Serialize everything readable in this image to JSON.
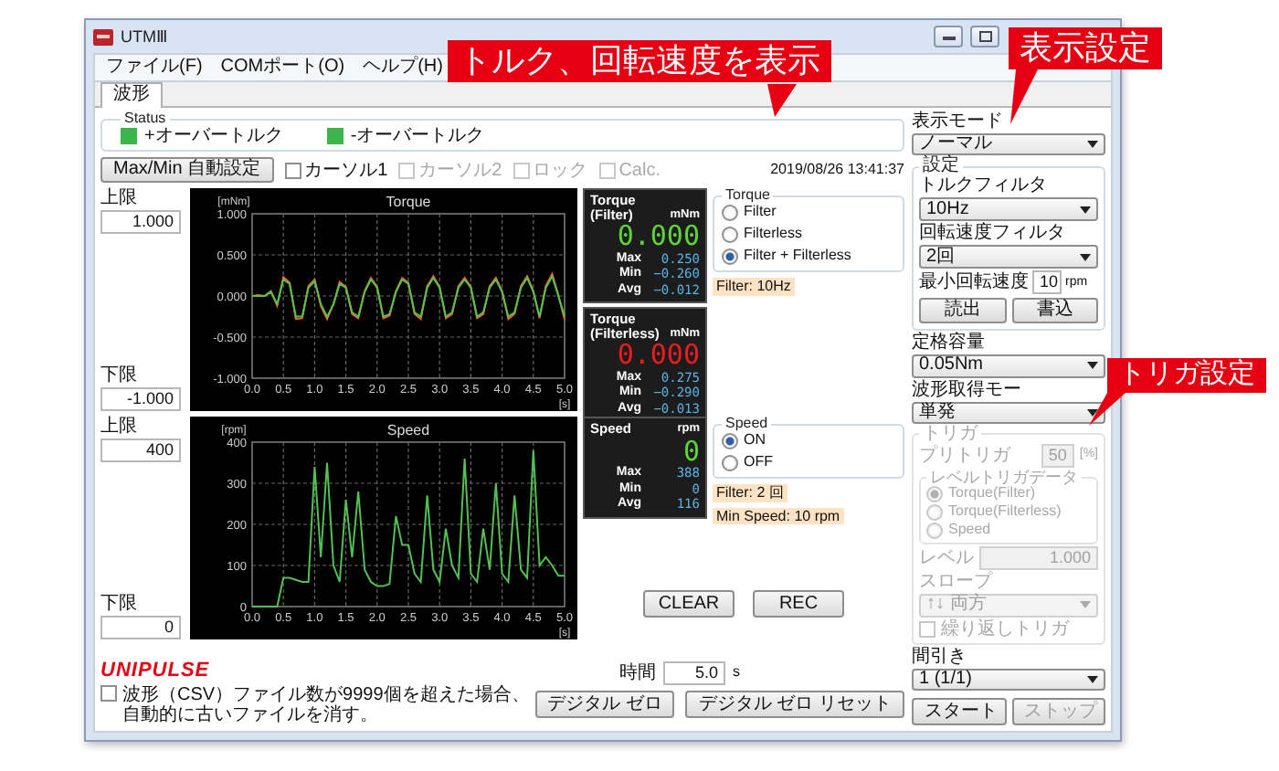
{
  "window": {
    "title": "UTMⅢ"
  },
  "menu": [
    "ファイル(F)",
    "COMポート(O)",
    "ヘルプ(H)"
  ],
  "tabs": [
    {
      "label": "波形",
      "selected": true
    }
  ],
  "status": {
    "label": "Status",
    "indicators": [
      {
        "label": "+オーバートルク",
        "color": "#3db54a"
      },
      {
        "label": "-オーバートルク",
        "color": "#3db54a"
      }
    ]
  },
  "toolbar": {
    "auto_button": "Max/Min 自動設定",
    "checkboxes": [
      {
        "label": "カーソル1",
        "checked": false,
        "disabled": false
      },
      {
        "label": "カーソル2",
        "checked": false,
        "disabled": true
      },
      {
        "label": "ロック",
        "checked": false,
        "disabled": true
      },
      {
        "label": "Calc.",
        "checked": false,
        "disabled": true
      }
    ],
    "timestamp": "2019/08/26 13:41:37"
  },
  "blocks": [
    {
      "upper": {
        "label": "上限",
        "value": "1.000"
      },
      "lower": {
        "label": "下限",
        "value": "-1.000"
      },
      "chart_data": {
        "type": "line",
        "grid": true,
        "title": "Torque",
        "ylabel": "[mNm]",
        "xlabel": "[s]",
        "xlim": [
          0,
          5
        ],
        "ylim": [
          -1,
          1
        ],
        "xticks": [
          {
            "value": 0,
            "label": "0.0"
          },
          {
            "value": 0.5,
            "label": "0.5"
          },
          {
            "value": 1,
            "label": "1.0"
          },
          {
            "value": 1.5,
            "label": "1.5"
          },
          {
            "value": 2,
            "label": "2.0"
          },
          {
            "value": 2.5,
            "label": "2.5"
          },
          {
            "value": 3,
            "label": "3.0"
          },
          {
            "value": 3.5,
            "label": "3.5"
          },
          {
            "value": 4,
            "label": "4.0"
          },
          {
            "value": 4.5,
            "label": "4.5"
          },
          {
            "value": 5,
            "label": "5.0"
          }
        ],
        "yticks": [
          {
            "value": -1,
            "label": "-1.000"
          },
          {
            "value": -0.5,
            "label": "-0.500"
          },
          {
            "value": 0,
            "label": "0.000"
          },
          {
            "value": 0.5,
            "label": "0.500"
          },
          {
            "value": 1,
            "label": "1.000"
          }
        ],
        "x": [
          0,
          0.1,
          0.2,
          0.3,
          0.4,
          0.5,
          0.6,
          0.7,
          0.8,
          0.9,
          1,
          1.1,
          1.2,
          1.3,
          1.4,
          1.5,
          1.6,
          1.7,
          1.8,
          1.9,
          2,
          2.1,
          2.2,
          2.3,
          2.4,
          2.5,
          2.6,
          2.7,
          2.8,
          2.9,
          3,
          3.1,
          3.2,
          3.3,
          3.4,
          3.5,
          3.6,
          3.7,
          3.8,
          3.9,
          4,
          4.1,
          4.2,
          4.3,
          4.4,
          4.5,
          4.6,
          4.7,
          4.8,
          4.9,
          5
        ],
        "series": [
          {
            "color": "#ff5a36",
            "values": [
              0,
              0.01,
              0,
              0.06,
              -0.12,
              0.23,
              0.16,
              -0.28,
              -0.27,
              0.12,
              0.2,
              -0.12,
              -0.28,
              -0.1,
              0.17,
              0.11,
              -0.22,
              -0.27,
              0.06,
              0.22,
              0.11,
              -0.27,
              -0.24,
              0.06,
              0.22,
              0.16,
              -0.22,
              -0.28,
              0.12,
              0.24,
              0.11,
              -0.27,
              -0.22,
              0.12,
              0.22,
              0.11,
              -0.27,
              -0.22,
              0.12,
              0.22,
              0.06,
              -0.28,
              -0.22,
              0.12,
              0.24,
              0.06,
              -0.27,
              0.12,
              0.27,
              0.01,
              -0.29
            ]
          },
          {
            "color": "#4fc64a",
            "values": [
              0,
              0,
              0,
              0.05,
              -0.1,
              0.2,
              0.15,
              -0.25,
              -0.25,
              0.1,
              0.18,
              -0.1,
              -0.25,
              -0.1,
              0.15,
              0.1,
              -0.2,
              -0.25,
              0.05,
              0.2,
              0.1,
              -0.25,
              -0.22,
              0.05,
              0.2,
              0.15,
              -0.2,
              -0.25,
              0.1,
              0.22,
              0.1,
              -0.25,
              -0.2,
              0.1,
              0.2,
              0.1,
              -0.25,
              -0.2,
              0.1,
              0.2,
              0.05,
              -0.25,
              -0.2,
              0.1,
              0.22,
              0.05,
              -0.25,
              0.1,
              0.24,
              0,
              -0.25
            ]
          }
        ]
      },
      "readouts": [
        {
          "title": [
            "Torque",
            "(Filter)"
          ],
          "unit": "mNm",
          "value": "0.000",
          "color": "#5fd43a",
          "stats": [
            {
              "label": "Max",
              "value": "0.250"
            },
            {
              "label": "Min",
              "value": "−0.260"
            },
            {
              "label": "Avg",
              "value": "−0.012"
            }
          ]
        },
        {
          "title": [
            "Torque",
            "(Filterless)"
          ],
          "unit": "mNm",
          "value": "0.000",
          "color": "#ee1c1c",
          "stats": [
            {
              "label": "Max",
              "value": "0.275"
            },
            {
              "label": "Min",
              "value": "−0.290"
            },
            {
              "label": "Avg",
              "value": "−0.013"
            }
          ]
        }
      ],
      "options": {
        "title": "Torque",
        "items": [
          {
            "label": "Filter",
            "selected": false
          },
          {
            "label": "Filterless",
            "selected": false
          },
          {
            "label": "Filter + Filterless",
            "selected": true
          }
        ]
      },
      "notes": [
        "Filter: 10Hz"
      ]
    },
    {
      "upper": {
        "label": "上限",
        "value": "400"
      },
      "lower": {
        "label": "下限",
        "value": "0"
      },
      "chart_data": {
        "type": "line",
        "grid": true,
        "title": "Speed",
        "ylabel": "[rpm]",
        "xlabel": "[s]",
        "xlim": [
          0,
          5
        ],
        "ylim": [
          0,
          400
        ],
        "xticks": [
          {
            "value": 0,
            "label": "0.0"
          },
          {
            "value": 0.5,
            "label": "0.5"
          },
          {
            "value": 1,
            "label": "1.0"
          },
          {
            "value": 1.5,
            "label": "1.5"
          },
          {
            "value": 2,
            "label": "2.0"
          },
          {
            "value": 2.5,
            "label": "2.5"
          },
          {
            "value": 3,
            "label": "3.0"
          },
          {
            "value": 3.5,
            "label": "3.5"
          },
          {
            "value": 4,
            "label": "4.0"
          },
          {
            "value": 4.5,
            "label": "4.5"
          },
          {
            "value": 5,
            "label": "5.0"
          }
        ],
        "yticks": [
          0,
          100,
          200,
          300,
          400
        ],
        "x": [
          0,
          0.1,
          0.2,
          0.3,
          0.4,
          0.5,
          0.6,
          0.7,
          0.8,
          0.9,
          1,
          1.1,
          1.2,
          1.3,
          1.4,
          1.5,
          1.6,
          1.7,
          1.8,
          1.9,
          2,
          2.1,
          2.2,
          2.3,
          2.4,
          2.5,
          2.6,
          2.7,
          2.8,
          2.9,
          3,
          3.1,
          3.2,
          3.3,
          3.4,
          3.5,
          3.6,
          3.7,
          3.8,
          3.9,
          4,
          4.1,
          4.2,
          4.3,
          4.4,
          4.5,
          4.6,
          4.7,
          4.8,
          4.9,
          5
        ],
        "series": [
          {
            "color": "#52c052",
            "values": [
              0,
              0,
              0,
              0,
              0,
              70,
              70,
              65,
              60,
              60,
              340,
              120,
              350,
              100,
              60,
              260,
              120,
              280,
              90,
              60,
              50,
              50,
              55,
              220,
              150,
              150,
              80,
              60,
              270,
              90,
              60,
              190,
              100,
              70,
              360,
              80,
              60,
              190,
              90,
              300,
              80,
              60,
              270,
              90,
              70,
              380,
              100,
              120,
              100,
              75,
              75
            ]
          }
        ]
      },
      "readouts": [
        {
          "title": [
            "Speed"
          ],
          "unit": "rpm",
          "value": "0",
          "color": "#5fd43a",
          "stats": [
            {
              "label": "Max",
              "value": "388"
            },
            {
              "label": "Min",
              "value": "0"
            },
            {
              "label": "Avg",
              "value": "116"
            }
          ]
        }
      ],
      "options": {
        "title": "Speed",
        "items": [
          {
            "label": "ON",
            "selected": true
          },
          {
            "label": "OFF",
            "selected": false
          }
        ]
      },
      "notes": [
        "Filter: 2 回",
        "Min Speed: 10 rpm"
      ]
    }
  ],
  "record_buttons": [
    "CLEAR",
    "REC"
  ],
  "logo": "UNIPULSE",
  "csv_option": {
    "label": "波形（CSV）ファイル数が9999個を超えた場合、自動的に古いファイルを消す。",
    "checked": false
  },
  "time": {
    "label": "時間",
    "value": "5.0",
    "unit": "s"
  },
  "zero_buttons": [
    "デジタル ゼロ",
    "デジタル ゼロ リセット"
  ],
  "side": {
    "display_mode": {
      "label": "表示モード",
      "value": "ノーマル"
    },
    "settings": {
      "title": "設定",
      "torque_filter": {
        "label": "トルクフィルタ",
        "value": "10Hz"
      },
      "speed_filter": {
        "label": "回転速度フィルタ",
        "value": "2回"
      },
      "min_speed": {
        "label": "最小回転速度",
        "value": "10",
        "unit": "rpm"
      },
      "buttons": [
        "読出",
        "書込"
      ]
    },
    "capacity": {
      "label": "定格容量",
      "value": "0.05Nm"
    },
    "acquire_mode": {
      "label": "波形取得モー",
      "value": "単発"
    },
    "trigger": {
      "title": "トリガ",
      "disabled": true,
      "pretrigger": {
        "label": "プリトリガ",
        "value": "50",
        "unit": "[%]"
      },
      "level_data": {
        "title": "レベルトリガデータ",
        "items": [
          {
            "label": "Torque(Filter)",
            "selected": true
          },
          {
            "label": "Torque(Filterless)",
            "selected": false
          },
          {
            "label": "Speed",
            "selected": false
          }
        ]
      },
      "level": {
        "label": "レベル",
        "value": "1.000"
      },
      "slope": {
        "label": "スロープ",
        "value": "↑↓ 両方"
      },
      "repeat": {
        "label": "繰り返しトリガ",
        "checked": false
      }
    },
    "decimation": {
      "label": "間引き",
      "value": "1 (1/1)"
    },
    "run_buttons": [
      {
        "label": "スタート",
        "disabled": false
      },
      {
        "label": "ストップ",
        "disabled": true
      }
    ]
  },
  "callouts": [
    {
      "text": "トルク、回転速度を表示"
    },
    {
      "text": "表示設定"
    },
    {
      "text": "トリガ設定"
    }
  ]
}
